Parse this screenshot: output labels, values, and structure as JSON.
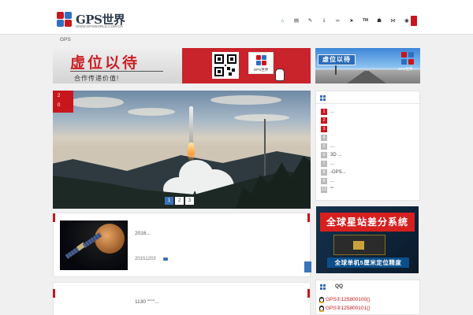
{
  "header": {
    "logo_text": "GPS世界",
    "logo_sub": "WWW.GPSWORLD.COM.CN",
    "logo_colors": [
      "#c8161d",
      "#2e6fc2",
      "#2e6fc2",
      "#c8161d"
    ],
    "nav_icons": [
      {
        "name": "home-icon",
        "glyph": "⌂",
        "active": true
      },
      {
        "name": "newspaper-icon",
        "glyph": "▤"
      },
      {
        "name": "edit-icon",
        "glyph": "✎"
      },
      {
        "name": "download-icon",
        "glyph": "⤓"
      },
      {
        "name": "link-icon",
        "glyph": "∞"
      },
      {
        "name": "send-icon",
        "glyph": "➤"
      },
      {
        "name": "trademark-icon",
        "glyph": "TM"
      },
      {
        "name": "users-icon",
        "glyph": "☗"
      },
      {
        "name": "share-icon",
        "glyph": "⋈"
      },
      {
        "name": "chat-icon",
        "glyph": "◉"
      }
    ]
  },
  "breadcrumb": "GPS",
  "banner_left": {
    "title": "虚位以待",
    "subtitle": "合作传递价值!",
    "badge_text": "GPS世界"
  },
  "banner_right": {
    "sign_text": "虚位以待",
    "logo_text": "GPS世界"
  },
  "hero": {
    "badge_lines": [
      "2",
      "0"
    ],
    "pages": [
      "1",
      "2",
      "3"
    ],
    "active_page": 0
  },
  "ranking": {
    "items": [
      {
        "num": "1",
        "text": "...",
        "hot": true
      },
      {
        "num": "2",
        "text": "",
        "hot": true
      },
      {
        "num": "3",
        "text": "",
        "hot": true
      },
      {
        "num": "4",
        "text": "",
        "hot": false
      },
      {
        "num": "5",
        "text": "...",
        "hot": false
      },
      {
        "num": "6",
        "text": "3D ...",
        "hot": false
      },
      {
        "num": "7",
        "text": "...",
        "hot": false
      },
      {
        "num": "8",
        "text": "-GPS...",
        "hot": false
      },
      {
        "num": "9",
        "text": "...",
        "hot": false
      },
      {
        "num": "10",
        "text": "\"\"",
        "hot": false
      }
    ]
  },
  "side_ad": {
    "top_text": "全球星站差分系统",
    "bottom_text": "全球单机5厘米定位精度"
  },
  "articles": [
    {
      "excerpt": "2016...",
      "date": "20151203"
    },
    {
      "excerpt": "1130 \"\"\"\"..."
    }
  ],
  "qq": {
    "title": "QQ",
    "groups": [
      "GPS①125800100()",
      "GPS②125800101()"
    ]
  }
}
